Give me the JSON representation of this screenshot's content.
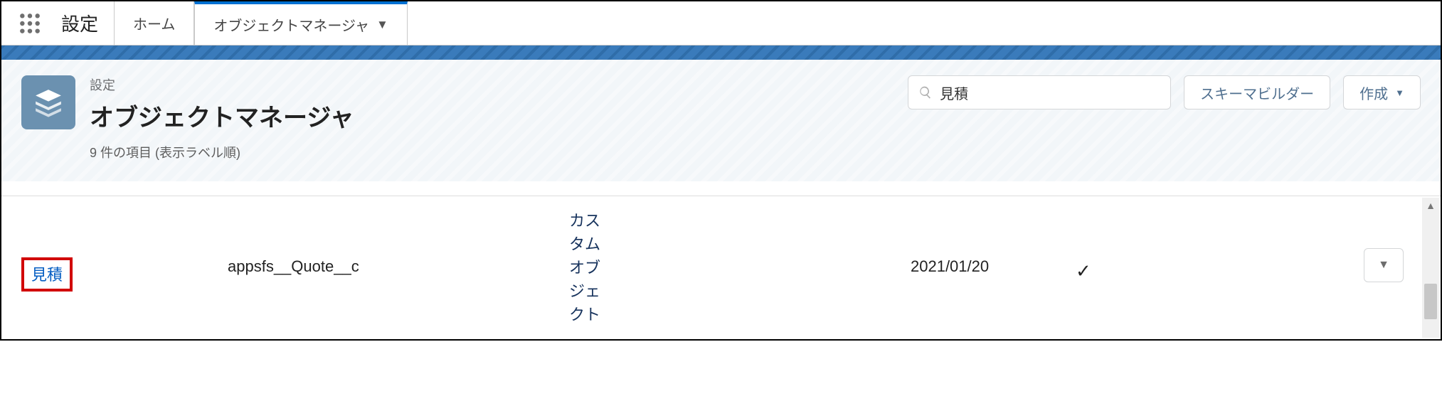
{
  "topbar": {
    "app_title": "設定",
    "tabs": [
      {
        "label": "ホーム",
        "active": false
      },
      {
        "label": "オブジェクトマネージャ",
        "active": true
      }
    ]
  },
  "header": {
    "crumb": "設定",
    "title": "オブジェクトマネージャ",
    "meta_count": "9",
    "meta_suffix": "件の項目 (表示ラベル順)"
  },
  "actions": {
    "search_value": "見積",
    "schema_builder": "スキーマビルダー",
    "create": "作成"
  },
  "rows": [
    {
      "label": "見積",
      "api_name": "appsfs__Quote__c",
      "type": "カス\nタム\nオブ\nジェ\nクト",
      "last_modified": "2021/01/20",
      "deployed": true
    }
  ]
}
